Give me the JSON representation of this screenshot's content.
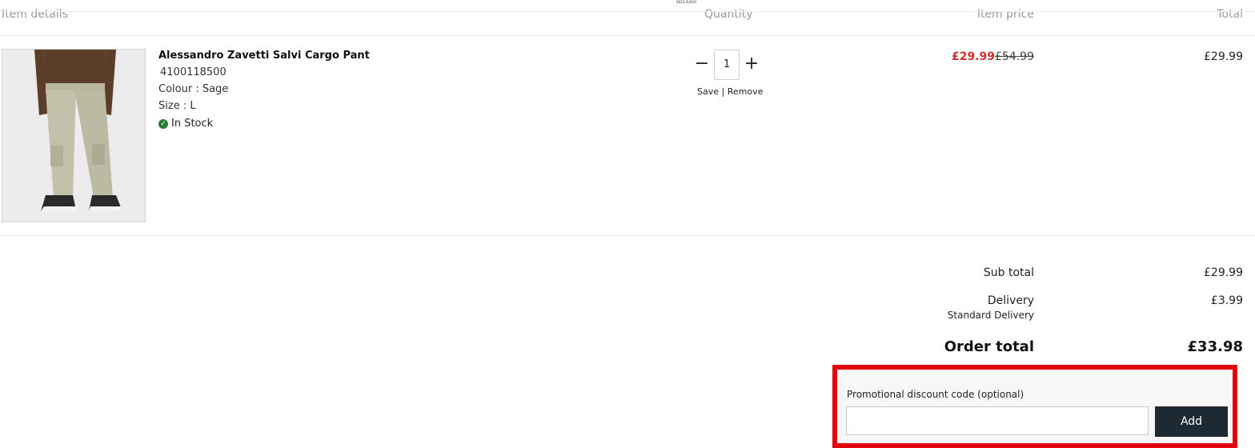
{
  "header": {
    "brand_mark": "MILANO",
    "columns": {
      "item_details": "Item details",
      "quantity": "Quantity",
      "item_price": "Item price",
      "total": "Total"
    }
  },
  "item": {
    "name": "Alessandro Zavetti Salvi Cargo Pant",
    "code": "4100118500",
    "colour": "Colour : Sage",
    "size": "Size : L",
    "stock": "In Stock",
    "quantity": "1",
    "save_label": "Save",
    "separator": "|",
    "remove_label": "Remove",
    "sale_price": "£29.99",
    "original_price": "£54.99",
    "line_total": "£29.99"
  },
  "summary": {
    "subtotal_label": "Sub total",
    "subtotal_value": "£29.99",
    "delivery_label": "Delivery",
    "delivery_method": "Standard Delivery",
    "delivery_value": "£3.99",
    "order_total_label": "Order total",
    "order_total_value": "£33.98"
  },
  "promo": {
    "label": "Promotional discount code (optional)",
    "value": "",
    "button_label": "Add"
  },
  "colors": {
    "sale_red": "#d32f2f",
    "highlight_red": "#e3000f",
    "button_dark": "#1e2a33",
    "stock_green": "#2e7d32"
  },
  "icons": {
    "minus": "minus-icon",
    "plus": "plus-icon",
    "stock": "check-circle-icon"
  }
}
